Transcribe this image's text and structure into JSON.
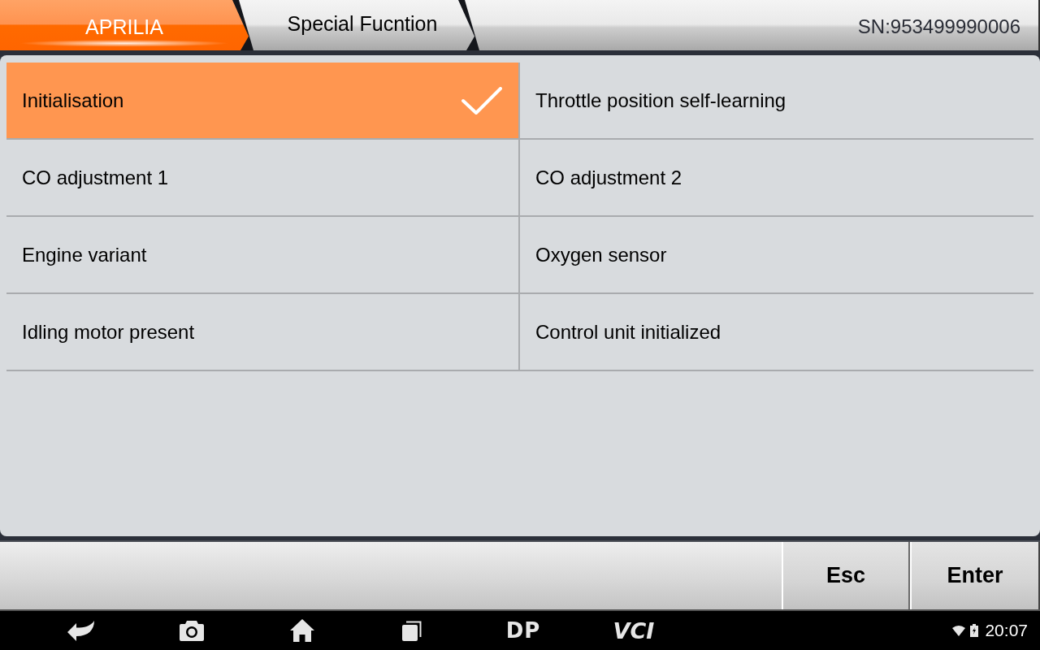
{
  "breadcrumb": [
    {
      "label": "APRILIA",
      "selected": true
    },
    {
      "label": "Special Fucntion",
      "selected": false
    }
  ],
  "serial_number": "SN:953499990006",
  "functions": [
    {
      "label": "Initialisation",
      "selected": true
    },
    {
      "label": "Throttle position self-learning",
      "selected": false
    },
    {
      "label": "CO adjustment 1",
      "selected": false
    },
    {
      "label": "CO adjustment 2",
      "selected": false
    },
    {
      "label": "Engine variant",
      "selected": false
    },
    {
      "label": "Oxygen sensor",
      "selected": false
    },
    {
      "label": "Idling motor present",
      "selected": false
    },
    {
      "label": "Control unit initialized",
      "selected": false
    }
  ],
  "toolbar": {
    "buttons": [
      "Esc",
      "Enter"
    ]
  },
  "nav_bar": {
    "logo_buttons": [
      "DP",
      "VCI"
    ],
    "time": "20:07"
  }
}
